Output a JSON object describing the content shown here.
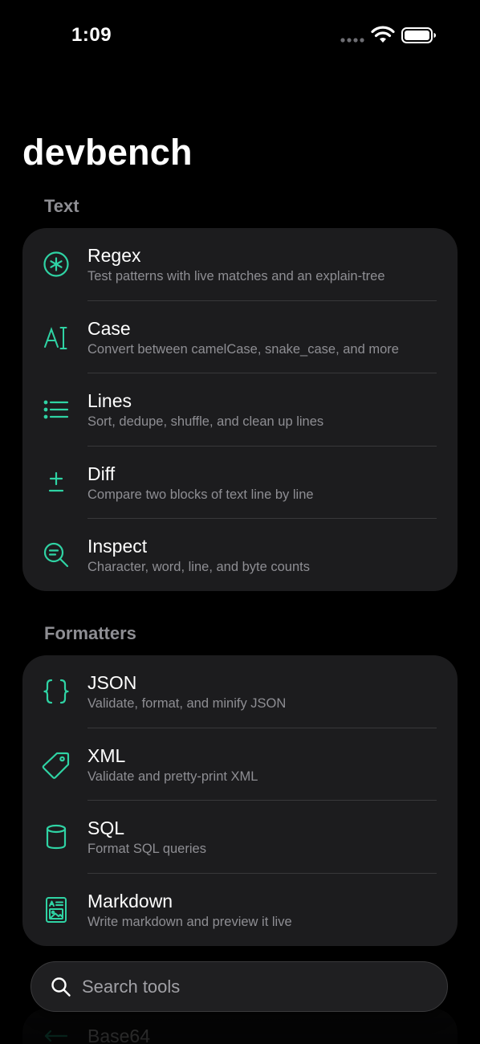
{
  "status_bar": {
    "time": "1:09"
  },
  "app": {
    "title": "devbench",
    "accent_color": "#2fd3a4"
  },
  "sections": [
    {
      "header": "Text",
      "items": [
        {
          "title": "Regex",
          "subtitle": "Test patterns with live matches and an explain-tree",
          "icon": "asterisk-circle-icon"
        },
        {
          "title": "Case",
          "subtitle": "Convert between camelCase, snake_case, and more",
          "icon": "text-case-icon"
        },
        {
          "title": "Lines",
          "subtitle": "Sort, dedupe, shuffle, and clean up lines",
          "icon": "list-icon"
        },
        {
          "title": "Diff",
          "subtitle": "Compare two blocks of text line by line",
          "icon": "plus-minus-icon"
        },
        {
          "title": "Inspect",
          "subtitle": "Character, word, line, and byte counts",
          "icon": "magnifier-text-icon"
        }
      ]
    },
    {
      "header": "Formatters",
      "items": [
        {
          "title": "JSON",
          "subtitle": "Validate, format, and minify JSON",
          "icon": "curly-braces-icon"
        },
        {
          "title": "XML",
          "subtitle": "Validate and pretty-print XML",
          "icon": "tag-icon"
        },
        {
          "title": "SQL",
          "subtitle": "Format SQL queries",
          "icon": "database-icon"
        },
        {
          "title": "Markdown",
          "subtitle": "Write markdown and preview it live",
          "icon": "document-preview-icon"
        }
      ]
    }
  ],
  "peek_item": {
    "title": "Base64",
    "icon": "arrows-icon"
  },
  "search": {
    "placeholder": "Search tools",
    "value": ""
  }
}
